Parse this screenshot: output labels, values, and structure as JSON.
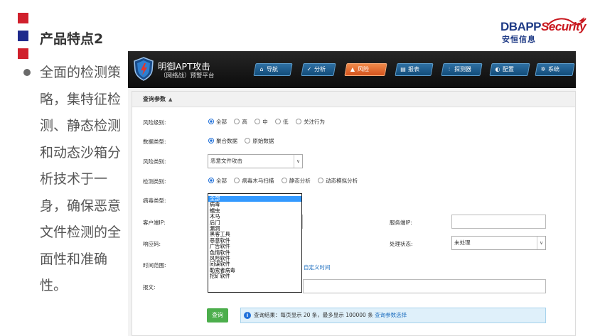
{
  "slide": {
    "title": "产品特点2",
    "bullet": "全面的检测策略，集特征检测、静态检测和动态沙箱分析技术于一身，确保恶意文件检测的全面性和准确性。",
    "logo": {
      "brand_prefix": "DB",
      "brand_mid": "APP",
      "brand_suffix": "ecurity",
      "brand_s": "S",
      "brand_cn": "安恒信息"
    },
    "colors": {
      "red": "#d0202c",
      "navy": "#1e2a8c",
      "logo_blue": "#1f3b86"
    }
  },
  "app": {
    "title": "明御APT攻击",
    "subtitle": "（网络战）预警平台",
    "nav": [
      {
        "label": "导航",
        "icon": "home-icon",
        "glyph": "⌂"
      },
      {
        "label": "分析",
        "icon": "chart-icon",
        "glyph": "✓"
      },
      {
        "label": "风险",
        "icon": "warning-icon",
        "glyph": "▲",
        "active": true
      },
      {
        "label": "报表",
        "icon": "report-icon",
        "glyph": "▤"
      },
      {
        "label": "探测器",
        "icon": "sliders-icon",
        "glyph": "⫶"
      },
      {
        "label": "配置",
        "icon": "pie-icon",
        "glyph": "◐"
      },
      {
        "label": "系统",
        "icon": "gear-icon",
        "glyph": "✲"
      }
    ],
    "panel": {
      "header": "查询参数",
      "risk_level": {
        "label": "风险级别:",
        "options": [
          "全部",
          "高",
          "中",
          "低",
          "关注行为"
        ],
        "selected": 0
      },
      "data_type": {
        "label": "数据类型:",
        "options": [
          "聚合数据",
          "原始数据"
        ],
        "selected": 0
      },
      "risk_category": {
        "label": "风险类别:",
        "value": "恶意文件攻击"
      },
      "detect_category": {
        "label": "检测类别:",
        "options": [
          "全部",
          "病毒木马扫描",
          "静态分析",
          "动态模拟分析"
        ],
        "selected": 0
      },
      "virus_type": {
        "label": "病毒类型:",
        "options": [
          "全部",
          "病毒",
          "蠕虫",
          "木马",
          "后门",
          "漏洞",
          "黑客工具",
          "恶意软件",
          "广告软件",
          "色情软件",
          "风险软件",
          "间谍软件",
          "勒索者病毒",
          "挖矿软件"
        ],
        "selected": 0
      },
      "client_ip": {
        "label": "客户端IP:"
      },
      "server_ip": {
        "label": "服务端IP:"
      },
      "response_code": {
        "label": "响应码:"
      },
      "process_status": {
        "label": "处理状态:",
        "value": "未处理"
      },
      "time_range": {
        "label": "时间范围:",
        "custom_link": "自定义时间"
      },
      "message": {
        "label": "报文:"
      },
      "query_button": "查询",
      "info": {
        "text": "查询结果：每页显示 20 条，最多显示 100000 条",
        "link": "查询参数选择"
      }
    }
  }
}
